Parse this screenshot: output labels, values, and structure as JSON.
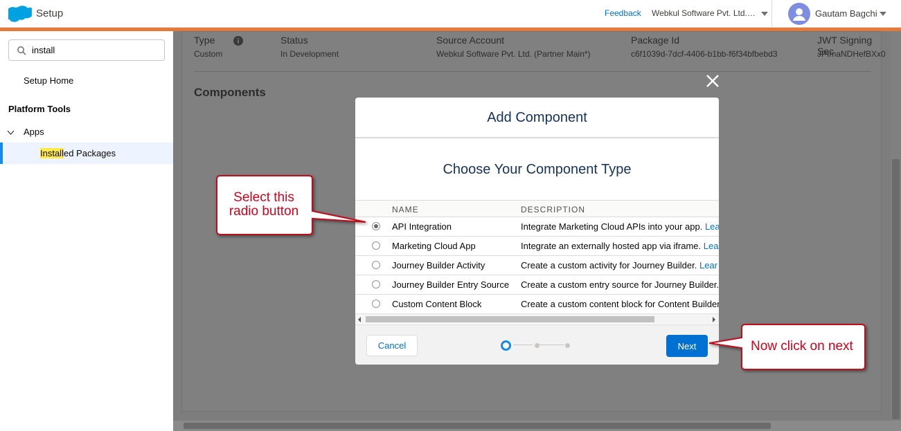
{
  "header": {
    "app_title": "Setup",
    "feedback": "Feedback",
    "org_name": "Webkul Software Pvt. Ltd. (Partner Main*)",
    "user_name": "Gautam Bagchi"
  },
  "sidebar": {
    "search_value": "install",
    "home": "Setup Home",
    "section": "Platform Tools",
    "apps": "Apps",
    "active_item_highlight": "Install",
    "active_item_rest": "ed Packages"
  },
  "main": {
    "fields": [
      {
        "label": "Type",
        "value": "Custom"
      },
      {
        "label": "Status",
        "value": "In Development"
      },
      {
        "label": "Source Account",
        "value": "Webkul Software Pvt. Ltd. (Partner Main*)"
      },
      {
        "label": "Package Id",
        "value": "c6f1039d-7dcf-4406-b1bb-f6f34bfbebd3"
      },
      {
        "label": "JWT Signing Sec",
        "value": "JPImaNDHefBXx0"
      }
    ],
    "components_heading": "Components"
  },
  "modal": {
    "title": "Add Component",
    "subtitle": "Choose Your Component Type",
    "columns": [
      "NAME",
      "DESCRIPTION"
    ],
    "rows": [
      {
        "name": "API Integration",
        "desc": "Integrate Marketing Cloud APIs into your app.",
        "learn": "Lea",
        "selected": true
      },
      {
        "name": "Marketing Cloud App",
        "desc": "Integrate an externally hosted app via iframe.",
        "learn": "Lea",
        "selected": false
      },
      {
        "name": "Journey Builder Activity",
        "desc": "Create a custom activity for Journey Builder.",
        "learn": "Lear",
        "selected": false
      },
      {
        "name": "Journey Builder Entry Source",
        "desc": "Create a custom entry source for Journey Builder.",
        "learn": "",
        "selected": false
      },
      {
        "name": "Custom Content Block",
        "desc": "Create a custom content block for Content Builder",
        "learn": "",
        "selected": false
      }
    ],
    "cancel_label": "Cancel",
    "next_label": "Next"
  },
  "callouts": {
    "select": "Select this radio button",
    "next": "Now click on next"
  },
  "colors": {
    "brand_blue": "#0070d2",
    "header_accent": "#e5793a",
    "callout_red": "#d0021b"
  }
}
